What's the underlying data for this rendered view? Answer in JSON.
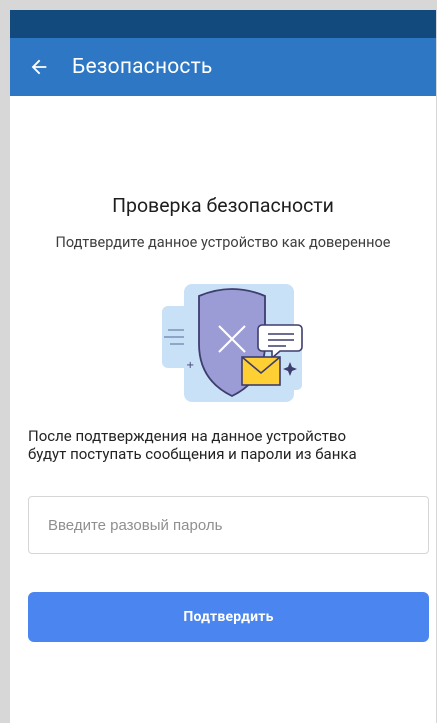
{
  "app_bar": {
    "title": "Безопасность",
    "back_icon": "arrow-left-icon"
  },
  "main": {
    "heading": "Проверка безопасности",
    "subheading": "Подтвердите данное устройство как доверенное",
    "illustration_icon": "shield-message-icon",
    "note_line1": "После подтверждения на данное устройство",
    "note_line2": "будут поступать сообщения и пароли из банка",
    "password_input": {
      "value": "",
      "placeholder": "Введите разовый пароль"
    },
    "confirm_label": "Подтвердить"
  },
  "colors": {
    "status_bar": "#134a7e",
    "app_bar": "#2d77c4",
    "button": "#4b86f0"
  }
}
